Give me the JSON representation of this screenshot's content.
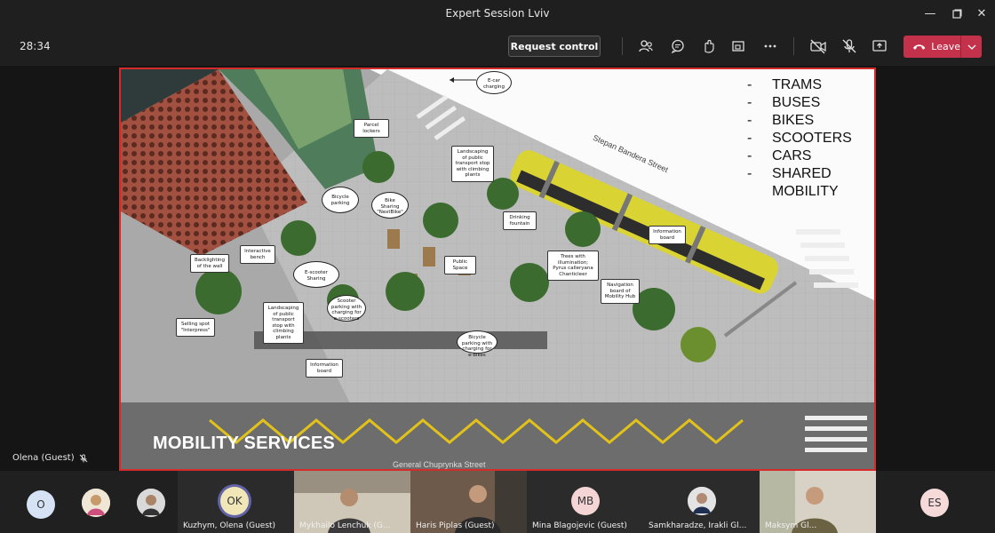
{
  "window": {
    "title": "Expert Session Lviv"
  },
  "toolbar": {
    "timer": "28:34",
    "request_control_label": "Request control",
    "leave_label": "Leave"
  },
  "presenter": {
    "name": "Olena (Guest)"
  },
  "slide": {
    "heading": "MOBILITY SERVICES",
    "modes": [
      "TRAMS",
      "BUSES",
      "BIKES",
      "SCOOTERS",
      "CARS",
      "SHARED",
      "MOBILITY"
    ],
    "streets": {
      "top": "Stepan Bandera Street",
      "bottom": "General Chuprynka Street"
    },
    "callouts": [
      "E-car charging",
      "Parcel lockers",
      "Landscaping of public transport stop with climbing plants",
      "Bicycle parking",
      "Bike Sharing \"NextBike\"",
      "Drinking fountain",
      "Information board",
      "Backlighting of the wall",
      "Interactive bench",
      "E-scooter Sharing",
      "Public Space",
      "Trees with illumination; Pyrus calleryana Chanticleer",
      "Navigation board of Mobility Hub",
      "Landscaping of public transport stop with climbing plants",
      "Scooter parking with charging for e-scooters",
      "Selling spot \"Interpress\"",
      "Bicycle parking with charging for e-bikes",
      "Information board"
    ]
  },
  "participants": [
    {
      "initials": "O",
      "name": "",
      "avatar_color": "#d5e3f5"
    },
    {
      "initials": "",
      "name": "",
      "avatar_color": "#e9d7b4"
    },
    {
      "initials": "",
      "name": "",
      "avatar_color": "#bcbcbc"
    },
    {
      "initials": "OK",
      "name": "Kuzhym, Olena (Guest)",
      "avatar_color": "#f1e6b8"
    },
    {
      "initials": "",
      "name": "Mykhailo Lenchuk (G..."
    },
    {
      "initials": "",
      "name": "Haris Piplas (Guest)"
    },
    {
      "initials": "MB",
      "name": "Mina Blagojevic (Guest)",
      "avatar_color": "#f4d4d4"
    },
    {
      "initials": "",
      "name": "Samkharadze, Irakli Gl...",
      "avatar_color": "#c9c9c9"
    },
    {
      "initials": "",
      "name": "Maksym Gl..."
    },
    {
      "initials": "ES",
      "name": "",
      "avatar_color": "#f6d9d9"
    }
  ]
}
